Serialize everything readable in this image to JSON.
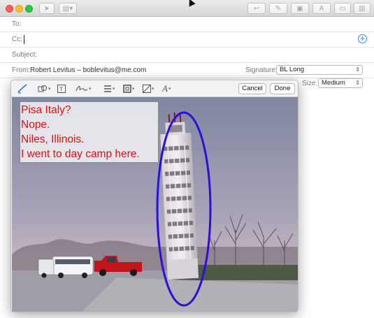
{
  "window": {
    "toolbar_icons": [
      "send-icon",
      "format-icon",
      "reply-icon",
      "attach-icon",
      "photo-icon",
      "font-icon",
      "window-icon",
      "sidebar-icon"
    ]
  },
  "header": {
    "to_label": "To:",
    "cc_label": "Cc:",
    "subject_label": "Subject:",
    "from_label": "From:",
    "from_value": "Robert Levitus – boblevitus@me.com",
    "signature_label": "Signature:",
    "signature_value": "BL Long",
    "size_label": "Size:",
    "size_value": "Medium"
  },
  "markup": {
    "cancel_label": "Cancel",
    "done_label": "Done",
    "tools": [
      "sketch-tool",
      "shapes-tool",
      "text-tool",
      "sign-tool",
      "line-style-tool",
      "border-color-tool",
      "fill-color-tool",
      "font-style-tool"
    ],
    "annotation_lines": [
      "Pisa Italy?",
      "Nope.",
      "Niles, Illinois.",
      "I went to day camp here."
    ],
    "colors": {
      "annotation_text": "#e01010",
      "ellipse": "#2a10d8",
      "sky": "#8a8fa6"
    }
  }
}
